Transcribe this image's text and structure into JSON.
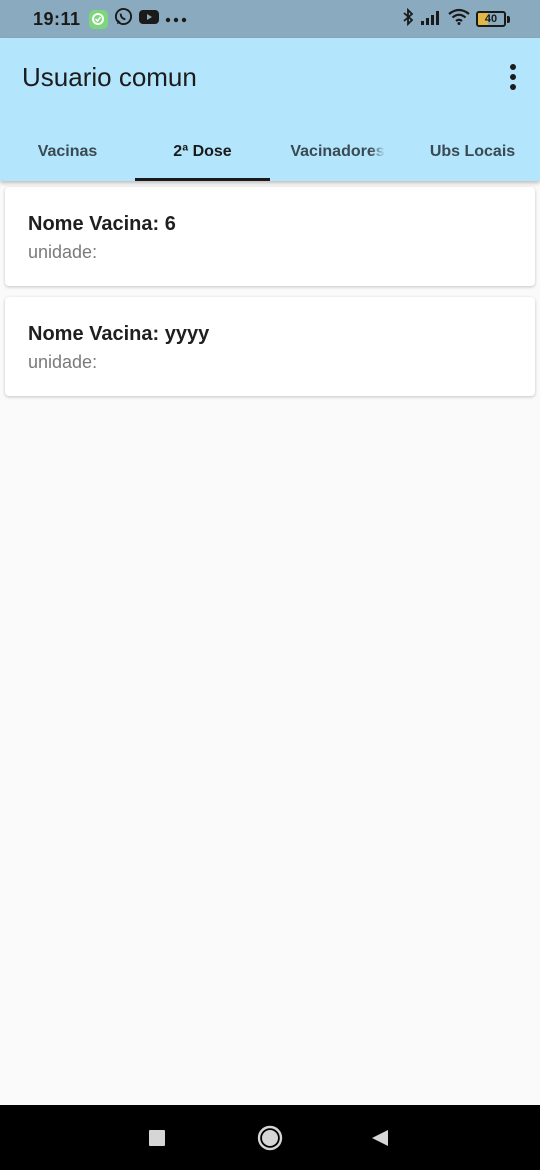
{
  "status_bar": {
    "time": "19:11",
    "battery_level": "40",
    "battery_fraction": 0.4,
    "left_icons": [
      "app-check-icon",
      "whatsapp-icon",
      "youtube-icon",
      "more-notifications-icon"
    ],
    "right_icons": [
      "bluetooth-icon",
      "signal-icon",
      "wifi-icon",
      "battery-icon"
    ]
  },
  "app_bar": {
    "title": "Usuario comun",
    "menu_icon": "more-vert-icon",
    "background": "#b3e5fc"
  },
  "tabs": [
    {
      "label": "Vacinas",
      "active": false
    },
    {
      "label": "2ª Dose",
      "active": true
    },
    {
      "label": "Vacinadores",
      "active": false
    },
    {
      "label": "Ubs Locais",
      "active": false
    }
  ],
  "cards": [
    {
      "title": "Nome Vacina: 6",
      "subtitle": "unidade:"
    },
    {
      "title": "Nome Vacina: yyyy",
      "subtitle": "unidade:"
    }
  ],
  "nav_bar": {
    "icons": [
      "recents-icon",
      "home-icon",
      "back-icon"
    ]
  }
}
